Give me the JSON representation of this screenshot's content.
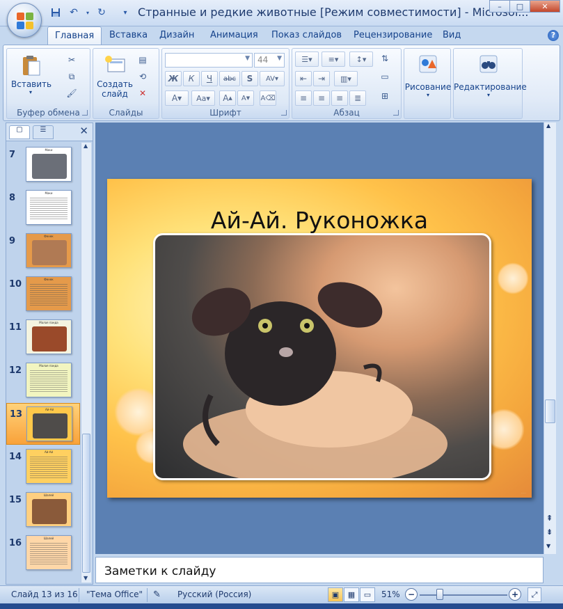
{
  "window": {
    "title": "Странные и редкие животные [Режим совместимости] - Microsof..."
  },
  "tabs": [
    "Главная",
    "Вставка",
    "Дизайн",
    "Анимация",
    "Показ слайдов",
    "Рецензирование",
    "Вид"
  ],
  "ribbon": {
    "clipboard": {
      "label": "Буфер обмена",
      "paste": "Вставить"
    },
    "slides": {
      "label": "Слайды",
      "new_slide_line1": "Создать",
      "new_slide_line2": "слайд"
    },
    "font": {
      "label": "Шрифт",
      "size": "44"
    },
    "paragraph": {
      "label": "Абзац"
    },
    "drawing": {
      "label": "Рисование"
    },
    "editing": {
      "label": "Редактирование"
    }
  },
  "thumbnails": [
    {
      "num": "7",
      "kind": "photo",
      "title": "Маки",
      "bg": "#ffffff",
      "pic": "#6b6f78"
    },
    {
      "num": "8",
      "kind": "text",
      "title": "Маки",
      "bg": "#ffffff"
    },
    {
      "num": "9",
      "kind": "photo",
      "title": "Фенек",
      "bg": "#e59a4a",
      "pic": "#b07a54"
    },
    {
      "num": "10",
      "kind": "text",
      "title": "Фенек",
      "bg": "#e59a4a"
    },
    {
      "num": "11",
      "kind": "photo",
      "title": "Малая панда",
      "bg": "#f4f4e0",
      "pic": "#9a4a2a"
    },
    {
      "num": "12",
      "kind": "text",
      "title": "Малая панда",
      "bg": "#f2f5c0"
    },
    {
      "num": "13",
      "kind": "photo",
      "title": "Ай-Ай",
      "bg": "#ffc84a",
      "pic": "#4f4c4a"
    },
    {
      "num": "14",
      "kind": "text",
      "title": "Ай-Ай",
      "bg": "#ffd060"
    },
    {
      "num": "15",
      "kind": "photo",
      "title": "Шалей",
      "bg": "#ffcf80",
      "pic": "#8a5a3a"
    },
    {
      "num": "16",
      "kind": "text",
      "title": "Шалей",
      "bg": "#ffd7a8"
    }
  ],
  "slide": {
    "title": "Ай-Ай. Руконожка"
  },
  "notes": {
    "placeholder": "Заметки к слайду"
  },
  "status": {
    "slide_of": "Слайд 13 из 16",
    "theme": "\"Тема Office\"",
    "language": "Русский (Россия)",
    "zoom": "51%"
  },
  "colors": {
    "accent": "#15428b",
    "selected": "#f9a23a"
  }
}
